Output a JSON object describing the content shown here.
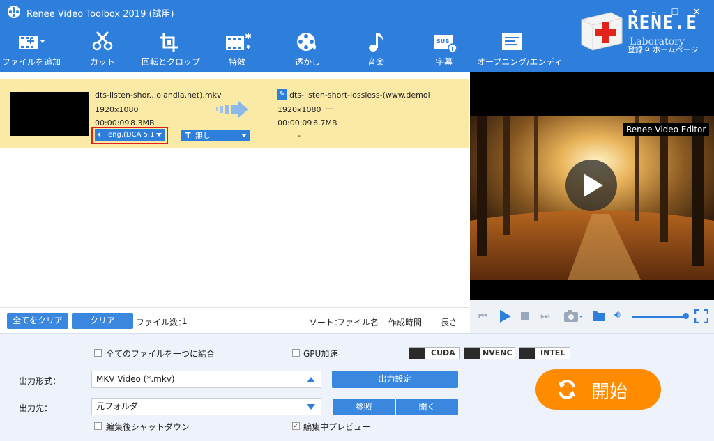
{
  "window": {
    "title": "Renee Video Toolbox 2019 (試用)"
  },
  "toolbar": {
    "items": [
      {
        "id": "add-file",
        "label": "ファイルを追加"
      },
      {
        "id": "cut",
        "label": "カット"
      },
      {
        "id": "rotate-crop",
        "label": "回転とクロップ"
      },
      {
        "id": "effects",
        "label": "特效"
      },
      {
        "id": "watermark",
        "label": "透かし"
      },
      {
        "id": "music",
        "label": "音楽"
      },
      {
        "id": "subtitle",
        "label": "字幕"
      },
      {
        "id": "opening-ending",
        "label": "オープニング/エンディ"
      }
    ]
  },
  "brand": {
    "name": "RENE.E",
    "sub": "Laboratory",
    "login": "登録",
    "home": "ホームページ"
  },
  "file": {
    "source": {
      "name": "dts-listen-shor...olandia.net).mkv",
      "resolution": "1920x1080",
      "duration": "00:00:09",
      "size": "8.3MB"
    },
    "output": {
      "name": "dts-listen-short-lossless-(www.demolanc",
      "resolution": "1920x1080",
      "extra": "···",
      "duration": "00:00:09",
      "size": "6.7MB"
    },
    "audio_track": "eng,(DCA 5.1",
    "subtitle": "無し",
    "dash": "-"
  },
  "list_bar": {
    "clear_all": "全てをクリア",
    "clear": "クリア",
    "file_count_label": "ファイル数：",
    "file_count": "1",
    "sort_label": "ソート：",
    "sort_name": "ファイル名",
    "sort_time": "作成時間",
    "sort_length": "長さ"
  },
  "preview": {
    "overlay": "Renee Video Editor"
  },
  "settings": {
    "merge_all": "全てのファイルを一つに結合",
    "gpu_accel": "GPU加速",
    "gpu_badges": [
      "CUDA",
      "NVENC",
      "INTEL"
    ],
    "output_format_label": "出力形式：",
    "output_format": "MKV Video (*.mkv)",
    "output_settings": "出力設定",
    "output_dest_label": "出力先：",
    "output_dest": "元フォルダ",
    "browse": "参照",
    "open": "開く",
    "shutdown_after": "編集後シャットダウン",
    "preview_while_editing": "編集中プレビュー",
    "preview_checked": true,
    "start": "開始"
  },
  "colors": {
    "header": "#2e7fdc",
    "row_highlight": "#fbeaa5",
    "start": "#ff8b00",
    "accent": "#3a87e0"
  }
}
